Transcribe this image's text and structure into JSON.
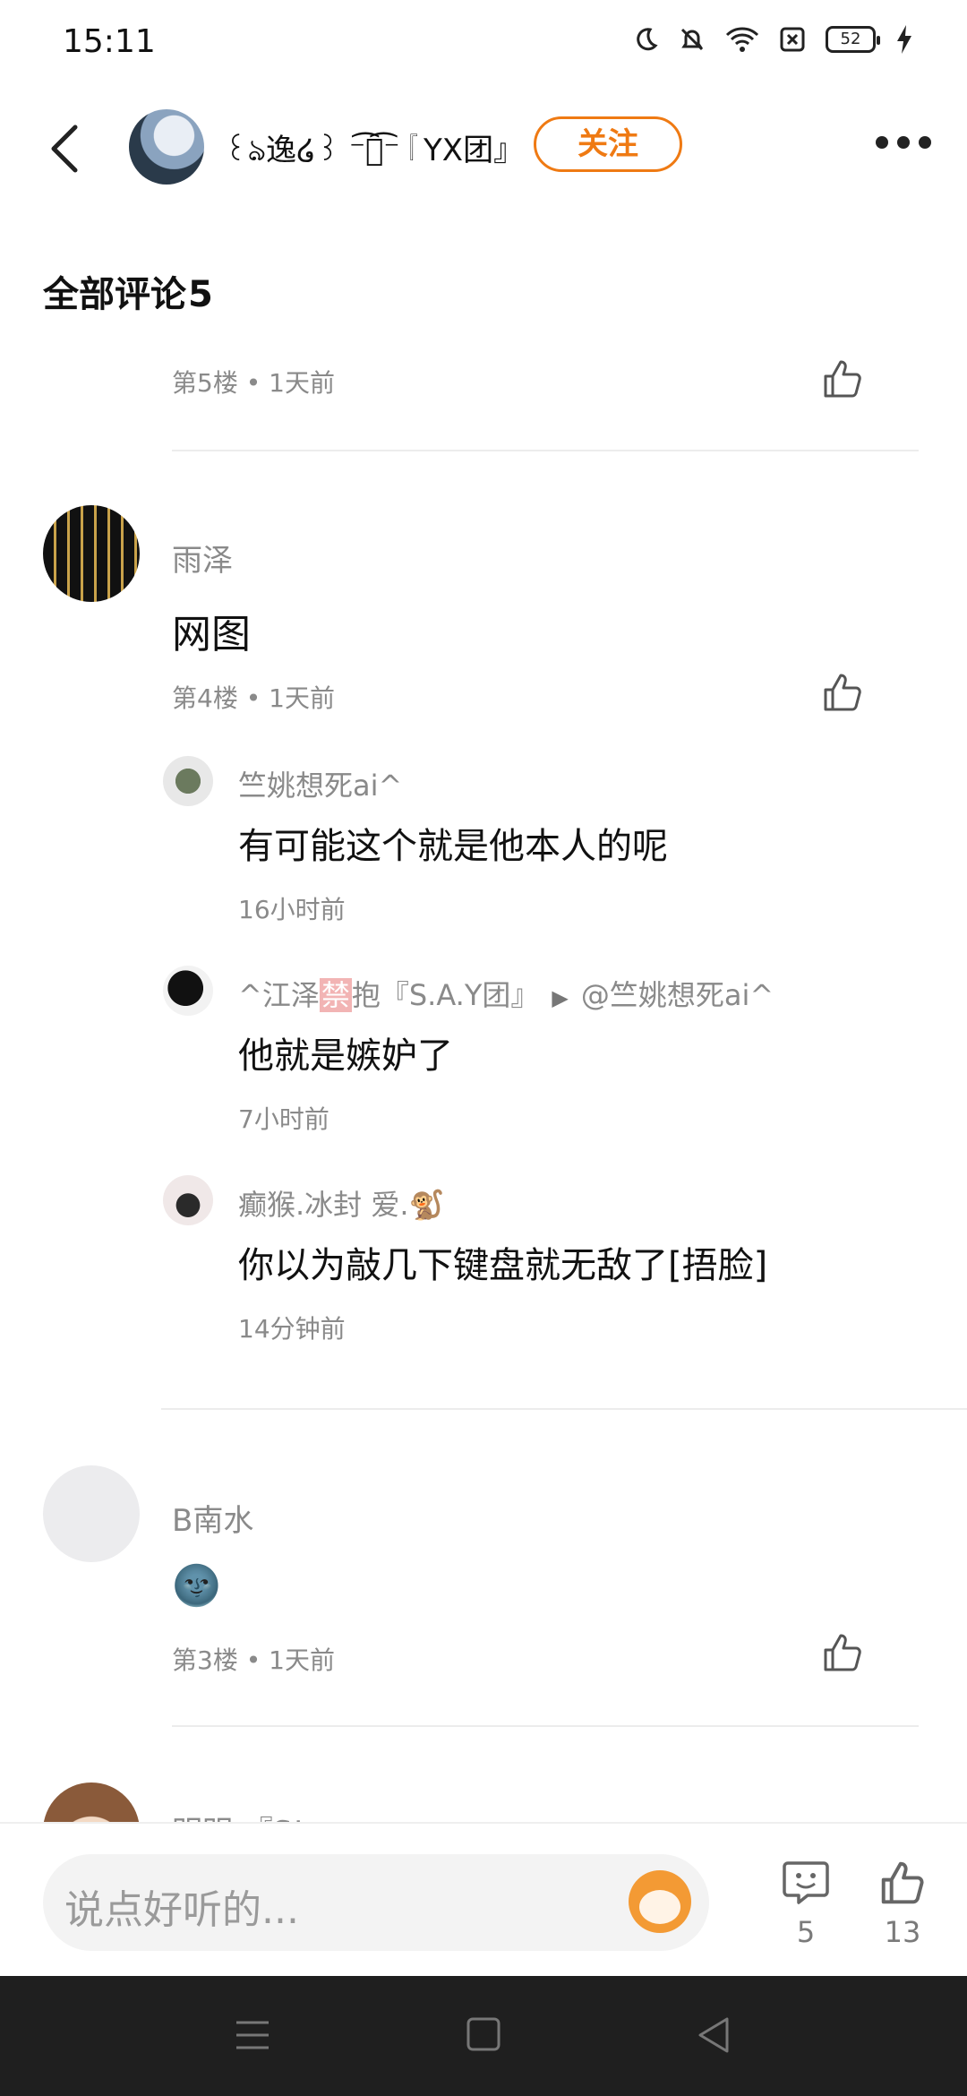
{
  "status_bar": {
    "time": "15:11",
    "battery": "52"
  },
  "header": {
    "name": "꒰ঌ逸໒꒱ ⁻͡🗡͡⁻『YX团』",
    "follow_label": "关注"
  },
  "section": {
    "title": "全部评论",
    "count": "5"
  },
  "comments": [
    {
      "meta": "第5楼 • 1天前"
    },
    {
      "username": "雨泽",
      "content": "网图",
      "meta": "第4楼 • 1天前",
      "replies": [
        {
          "user": "竺姚想死ai^",
          "text": "有可能这个就是他本人的呢",
          "time": "16小时前"
        },
        {
          "user_prefix": "^江泽",
          "user_ban": "禁",
          "user_suffix": "抱『S.A.Y团』",
          "reply_to": "@竺姚想死ai^",
          "text": "他就是嫉妒了",
          "time": "7小时前"
        },
        {
          "user": "癫猴.冰封 爱.🐒",
          "text": "你以为敲几下键盘就无敌了[捂脸]",
          "time": "14分钟前"
        }
      ]
    },
    {
      "username": "B南水",
      "content": "🌚",
      "meta": "第3楼 • 1天前"
    },
    {
      "username": "明明 『S!"
    }
  ],
  "bottom_bar": {
    "placeholder": "说点好听的...",
    "comment_count": "5",
    "like_count": "13"
  },
  "icons": {
    "back": "back-arrow-icon",
    "more": "more-dots-icon",
    "like": "thumbs-up-icon",
    "comment": "comment-bubble-icon",
    "menu": "menu-icon",
    "home": "home-square-icon",
    "nav_back": "triangle-back-icon"
  },
  "colors": {
    "accent": "#ef7a13",
    "meta_gray": "#8a8a8a",
    "nav_bg": "#1f1f1f"
  }
}
